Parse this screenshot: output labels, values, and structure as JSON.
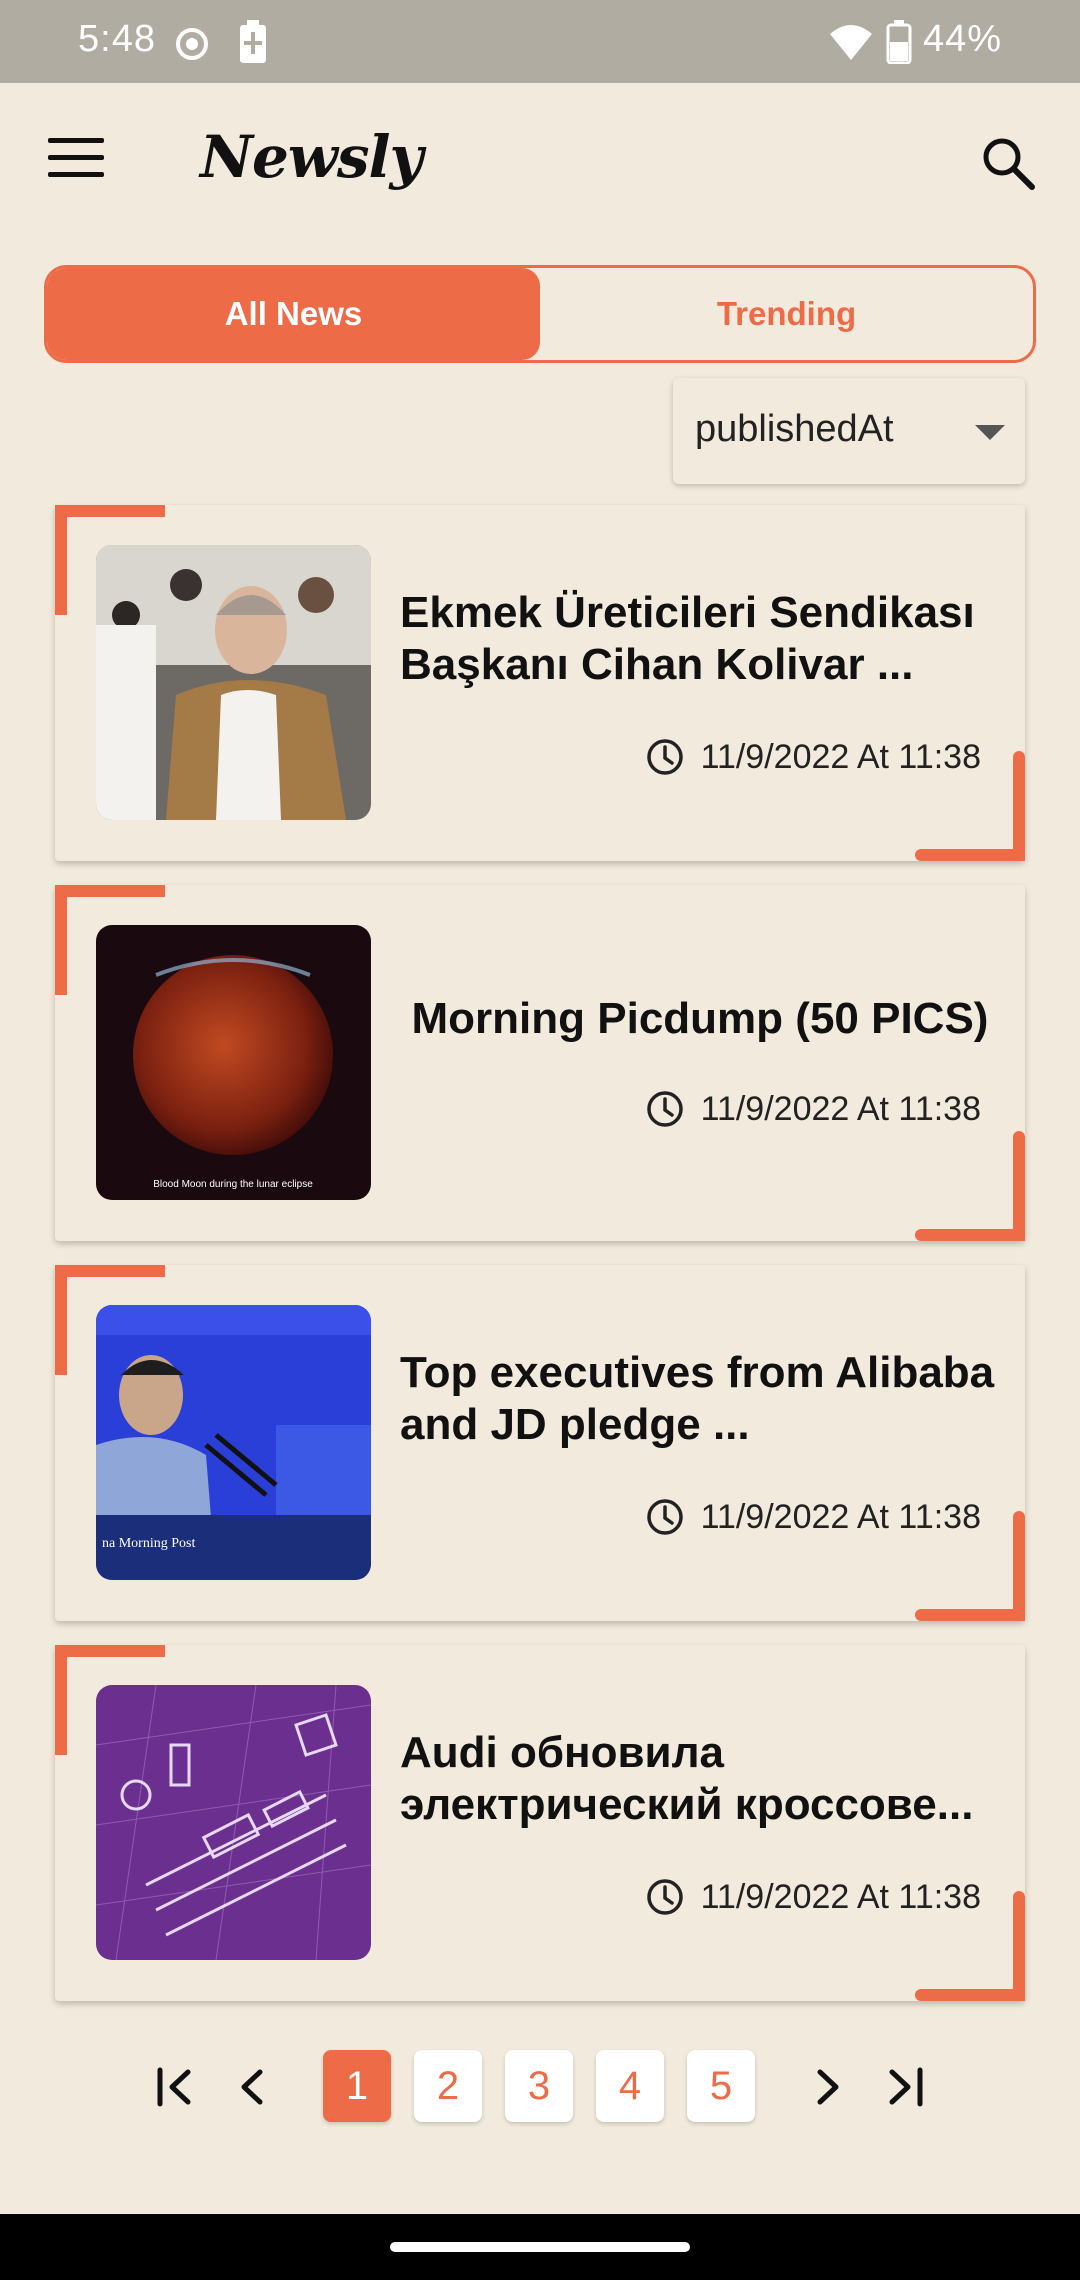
{
  "status_bar": {
    "time": "5:48",
    "battery_percent": "44%",
    "icons": [
      "record-icon",
      "battery-charging-icon",
      "wifi-icon",
      "battery-icon"
    ]
  },
  "app_bar": {
    "title": "Newsly",
    "menu_icon": "hamburger-menu-icon",
    "search_icon": "search-icon"
  },
  "tabs": [
    {
      "label": "All News",
      "active": true
    },
    {
      "label": "Trending",
      "active": false
    }
  ],
  "sort": {
    "selected": "publishedAt"
  },
  "articles": [
    {
      "title": "Ekmek Üreticileri Sendikası Başkanı Cihan Kolivar ...",
      "time": "11/9/2022 At 11:38",
      "image": "photo-man-in-crowd"
    },
    {
      "title": "Morning Picdump (50 PICS)",
      "time": "11/9/2022 At 11:38",
      "image": "photo-blood-moon",
      "image_caption": "Blood Moon during the lunar eclipse"
    },
    {
      "title": "Top executives from Alibaba and JD pledge ...",
      "time": "11/9/2022 At 11:38",
      "image": "photo-executive-speaking",
      "image_caption": "na Morning Post"
    },
    {
      "title": "Audi обновила электрический кроссове...",
      "time": "11/9/2022 At 11:38",
      "image": "illustration-smart-city"
    }
  ],
  "pagination": {
    "pages": [
      "1",
      "2",
      "3",
      "4",
      "5"
    ],
    "current": "1"
  },
  "colors": {
    "accent": "#ee6b47",
    "background": "#f2ebdd",
    "status_bar": "#b0aca2"
  }
}
